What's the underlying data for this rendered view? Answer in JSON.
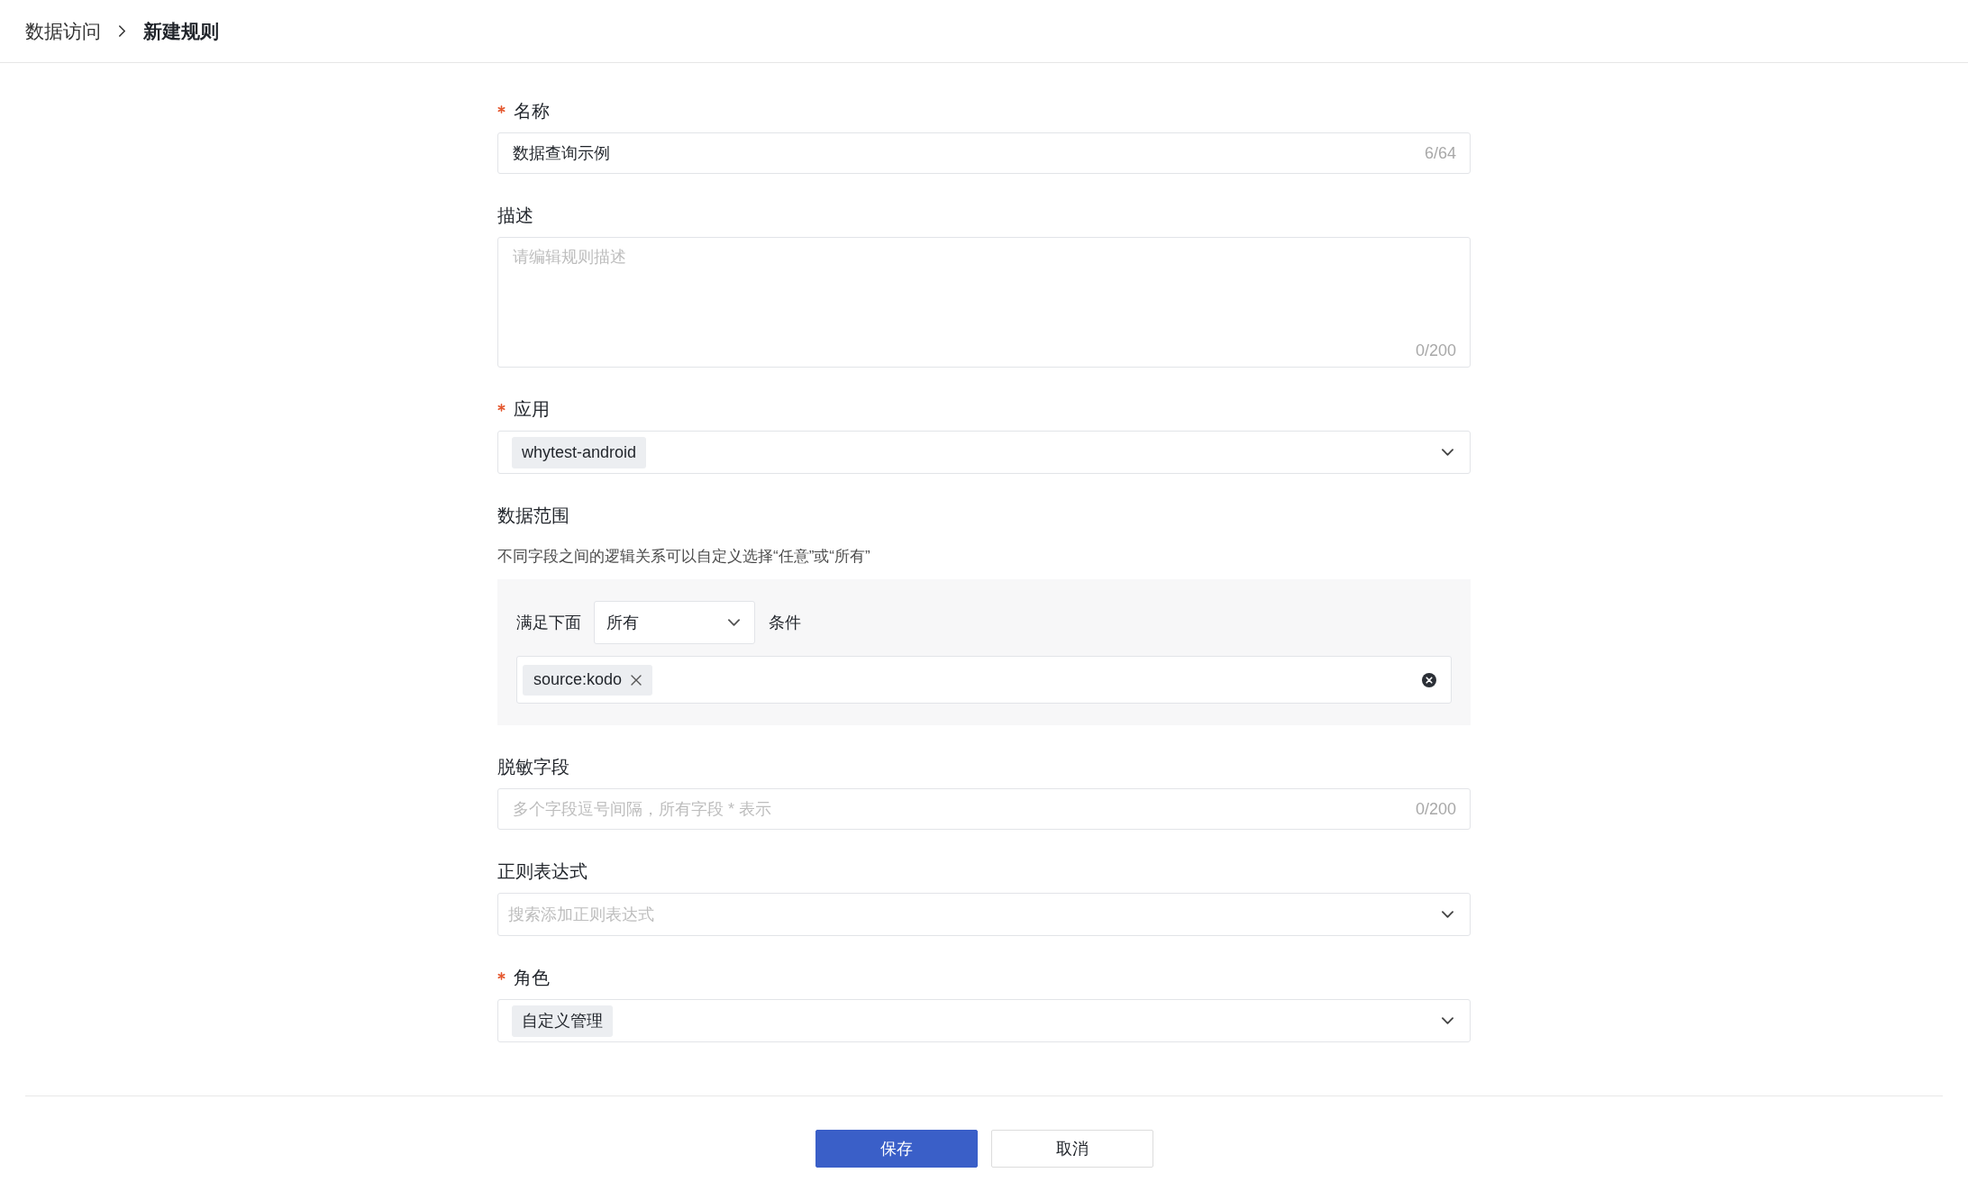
{
  "breadcrumb": [
    {
      "label": "数据访问",
      "current": false
    },
    {
      "label": "新建规则",
      "current": true
    }
  ],
  "form": {
    "fields": [
      {
        "kind": "text",
        "label": "名称",
        "required": true,
        "value": "数据查询示例",
        "counter": "6/64"
      },
      {
        "kind": "textarea",
        "label": "描述",
        "required": false,
        "placeholder": "请编辑规则描述",
        "counter": "0/200"
      },
      {
        "kind": "select",
        "label": "应用",
        "required": true,
        "tags": [
          "whytest-android"
        ]
      },
      {
        "kind": "scope",
        "label": "数据范围",
        "required": false,
        "help": "不同字段之间的逻辑关系可以自定义选择“任意”或“所有”",
        "prefix": "满足下面",
        "match": "所有",
        "suffix": "条件",
        "conditions": [
          "source:kodo"
        ]
      },
      {
        "kind": "text",
        "label": "脱敏字段",
        "required": false,
        "placeholder": "多个字段逗号间隔，所有字段 * 表示",
        "counter": "0/200"
      },
      {
        "kind": "select",
        "label": "正则表达式",
        "required": false,
        "placeholder": "搜索添加正则表达式"
      },
      {
        "kind": "select",
        "label": "角色",
        "required": true,
        "tags": [
          "自定义管理"
        ]
      }
    ]
  },
  "buttons": [
    {
      "label": "保存",
      "kind": "primary"
    },
    {
      "label": "取消",
      "kind": "default"
    }
  ]
}
